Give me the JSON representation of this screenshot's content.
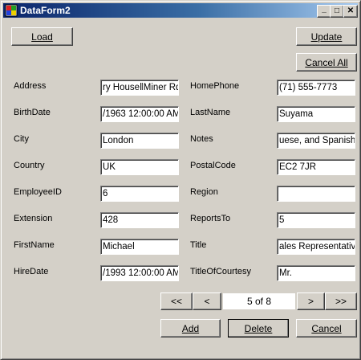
{
  "window": {
    "title": "DataForm2"
  },
  "caption_buttons": {
    "minimize": "_",
    "maximize": "□",
    "close": "✕"
  },
  "toolbar": {
    "load": "Load",
    "update": "Update",
    "cancel_all": "Cancel All"
  },
  "fields_left": [
    {
      "label": "Address",
      "value": "ry House‖Miner Rd."
    },
    {
      "label": "BirthDate",
      "value": "/1963 12:00:00 AM"
    },
    {
      "label": "City",
      "value": "London"
    },
    {
      "label": "Country",
      "value": "UK"
    },
    {
      "label": "EmployeeID",
      "value": "6"
    },
    {
      "label": "Extension",
      "value": "428"
    },
    {
      "label": "FirstName",
      "value": "Michael"
    },
    {
      "label": "HireDate",
      "value": "/1993 12:00:00 AM"
    }
  ],
  "fields_right": [
    {
      "label": "HomePhone",
      "value": "(71) 555-7773"
    },
    {
      "label": "LastName",
      "value": "Suyama"
    },
    {
      "label": "Notes",
      "value": "uese, and Spanish."
    },
    {
      "label": "PostalCode",
      "value": "EC2 7JR"
    },
    {
      "label": "Region",
      "value": ""
    },
    {
      "label": "ReportsTo",
      "value": "5"
    },
    {
      "label": "Title",
      "value": "ales Representative"
    },
    {
      "label": "TitleOfCourtesy",
      "value": "Mr."
    }
  ],
  "navigation": {
    "first": "<<",
    "prev": "<",
    "position": "5 of  8",
    "next": ">",
    "last": ">>"
  },
  "actions": {
    "add": "Add",
    "delete": "Delete",
    "cancel": "Cancel"
  }
}
